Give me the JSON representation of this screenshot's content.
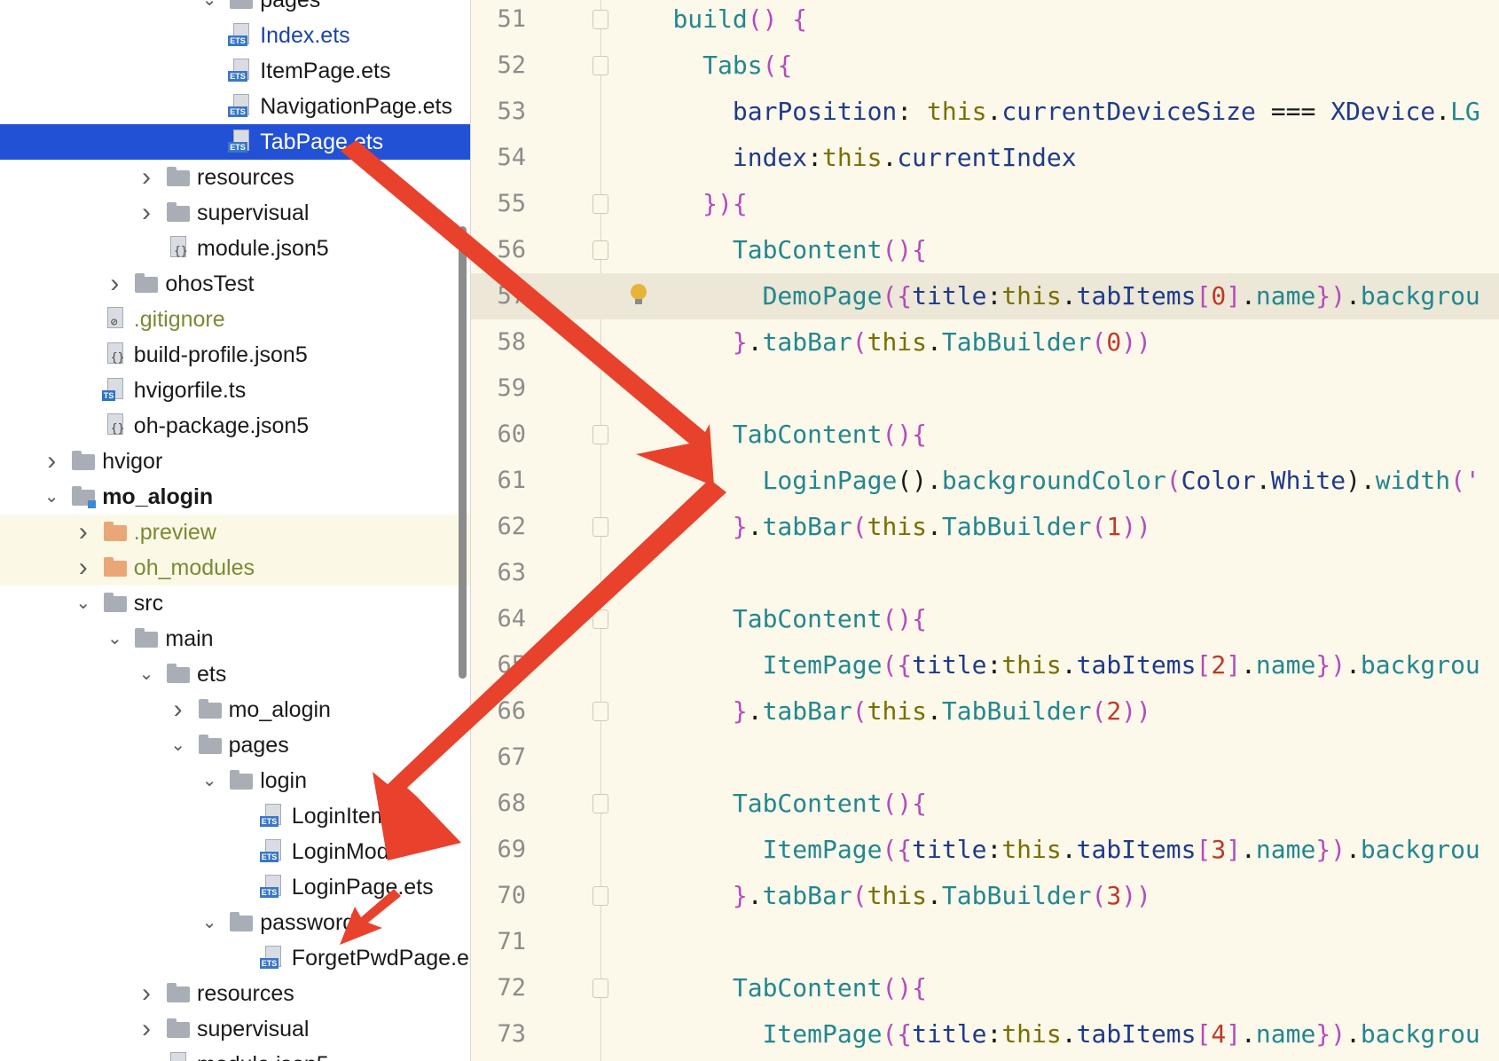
{
  "project_tree": {
    "items": [
      {
        "label": "pages",
        "depth": 7,
        "kind": "folder",
        "expand": "open"
      },
      {
        "label": "Index.ets",
        "depth": 7,
        "kind": "ets",
        "color": "#1c44a8"
      },
      {
        "label": "ItemPage.ets",
        "depth": 7,
        "kind": "ets"
      },
      {
        "label": "NavigationPage.ets",
        "depth": 7,
        "kind": "ets"
      },
      {
        "label": "TabPage.ets",
        "depth": 7,
        "kind": "ets",
        "selected": true
      },
      {
        "label": "resources",
        "depth": 5,
        "kind": "folder",
        "expand": "closed"
      },
      {
        "label": "supervisual",
        "depth": 5,
        "kind": "folder",
        "expand": "closed"
      },
      {
        "label": "module.json5",
        "depth": 5,
        "kind": "json"
      },
      {
        "label": "ohosTest",
        "depth": 4,
        "kind": "folder",
        "expand": "closed"
      },
      {
        "label": ".gitignore",
        "depth": 3,
        "kind": "ignore",
        "color": "#7b8a34"
      },
      {
        "label": "build-profile.json5",
        "depth": 3,
        "kind": "json"
      },
      {
        "label": "hvigorfile.ts",
        "depth": 3,
        "kind": "ts"
      },
      {
        "label": "oh-package.json5",
        "depth": 3,
        "kind": "json"
      },
      {
        "label": "hvigor",
        "depth": 2,
        "kind": "folder",
        "expand": "closed"
      },
      {
        "label": "mo_alogin",
        "depth": 2,
        "kind": "module",
        "expand": "open",
        "bold": true
      },
      {
        "label": ".preview",
        "depth": 3,
        "kind": "folder-orange",
        "expand": "closed",
        "color": "#7b8a34",
        "ignored": true
      },
      {
        "label": "oh_modules",
        "depth": 3,
        "kind": "folder-orange",
        "expand": "closed",
        "color": "#7b8a34",
        "ignored": true
      },
      {
        "label": "src",
        "depth": 3,
        "kind": "folder",
        "expand": "open"
      },
      {
        "label": "main",
        "depth": 4,
        "kind": "folder",
        "expand": "open"
      },
      {
        "label": "ets",
        "depth": 5,
        "kind": "folder",
        "expand": "open"
      },
      {
        "label": "mo_alogin",
        "depth": 6,
        "kind": "folder",
        "expand": "closed"
      },
      {
        "label": "pages",
        "depth": 6,
        "kind": "folder",
        "expand": "open"
      },
      {
        "label": "login",
        "depth": 7,
        "kind": "folder",
        "expand": "open"
      },
      {
        "label": "LoginItems",
        "depth": 8,
        "kind": "ets"
      },
      {
        "label": "LoginMod",
        "depth": 8,
        "kind": "ets"
      },
      {
        "label": "LoginPage.ets",
        "depth": 8,
        "kind": "ets"
      },
      {
        "label": "password",
        "depth": 7,
        "kind": "folder",
        "expand": "open"
      },
      {
        "label": "ForgetPwdPage.e",
        "depth": 8,
        "kind": "ets"
      },
      {
        "label": "resources",
        "depth": 5,
        "kind": "folder",
        "expand": "closed"
      },
      {
        "label": "supervisual",
        "depth": 5,
        "kind": "folder",
        "expand": "closed"
      },
      {
        "label": "module.json5",
        "depth": 5,
        "kind": "json"
      }
    ]
  },
  "file_tags": {
    "ets": "ETS",
    "ts": "TS"
  },
  "editor": {
    "lines": [
      {
        "n": "51",
        "fold": true,
        "code": [
          [
            "    ",
            "p"
          ],
          [
            "build",
            "f"
          ],
          [
            "() {",
            "b"
          ]
        ]
      },
      {
        "n": "52",
        "fold": true,
        "code": [
          [
            "      ",
            "p"
          ],
          [
            "Tabs",
            "f"
          ],
          [
            "({",
            "b"
          ]
        ]
      },
      {
        "n": "53",
        "code": [
          [
            "        ",
            "p"
          ],
          [
            "barPosition",
            "pr"
          ],
          [
            ": ",
            "p"
          ],
          [
            "this",
            "k"
          ],
          [
            ".",
            "p"
          ],
          [
            "currentDeviceSize",
            "pr"
          ],
          [
            " === ",
            "p"
          ],
          [
            "XDevice",
            "pr"
          ],
          [
            ".",
            "p"
          ],
          [
            "LG",
            "f"
          ]
        ]
      },
      {
        "n": "54",
        "code": [
          [
            "        ",
            "p"
          ],
          [
            "index",
            "pr"
          ],
          [
            ":",
            "p"
          ],
          [
            "this",
            "k"
          ],
          [
            ".",
            "p"
          ],
          [
            "currentIndex",
            "pr"
          ]
        ]
      },
      {
        "n": "55",
        "fold": true,
        "code": [
          [
            "      ",
            "p"
          ],
          [
            "})",
            "b"
          ],
          [
            "{",
            "b"
          ]
        ]
      },
      {
        "n": "56",
        "fold": true,
        "code": [
          [
            "        ",
            "p"
          ],
          [
            "TabContent",
            "f"
          ],
          [
            "(){",
            "b"
          ]
        ]
      },
      {
        "n": "57",
        "highlight": true,
        "bulb": true,
        "code": [
          [
            "          ",
            "p"
          ],
          [
            "DemoPage",
            "f"
          ],
          [
            "({",
            "b"
          ],
          [
            "title",
            "pr"
          ],
          [
            ":",
            "p"
          ],
          [
            "this",
            "k"
          ],
          [
            ".",
            "p"
          ],
          [
            "tabItems",
            "pr"
          ],
          [
            "[",
            "b"
          ],
          [
            "0",
            "n"
          ],
          [
            "]",
            "b"
          ],
          [
            ".",
            "p"
          ],
          [
            "name",
            "f"
          ],
          [
            "})",
            "b"
          ],
          [
            ".",
            "p"
          ],
          [
            "backgrou",
            "f"
          ]
        ]
      },
      {
        "n": "58",
        "code": [
          [
            "        ",
            "p"
          ],
          [
            "}",
            "b"
          ],
          [
            ".",
            "p"
          ],
          [
            "tabBar",
            "f"
          ],
          [
            "(",
            "b"
          ],
          [
            "this",
            "k"
          ],
          [
            ".",
            "p"
          ],
          [
            "TabBuilder",
            "f"
          ],
          [
            "(",
            "b"
          ],
          [
            "0",
            "n"
          ],
          [
            "))",
            "b"
          ]
        ]
      },
      {
        "n": "59",
        "code": []
      },
      {
        "n": "60",
        "fold": true,
        "code": [
          [
            "        ",
            "p"
          ],
          [
            "TabContent",
            "f"
          ],
          [
            "(){",
            "b"
          ]
        ]
      },
      {
        "n": "61",
        "code": [
          [
            "          ",
            "p"
          ],
          [
            "LoginPage",
            "f"
          ],
          [
            "().",
            "p"
          ],
          [
            "backgroundColor",
            "f"
          ],
          [
            "(",
            "b"
          ],
          [
            "Color",
            "pr"
          ],
          [
            ".",
            "p"
          ],
          [
            "White",
            "pr"
          ],
          [
            ").",
            "p"
          ],
          [
            "width",
            "f"
          ],
          [
            "('",
            "b"
          ]
        ]
      },
      {
        "n": "62",
        "fold": true,
        "code": [
          [
            "        ",
            "p"
          ],
          [
            "}",
            "b"
          ],
          [
            ".",
            "p"
          ],
          [
            "tabBar",
            "f"
          ],
          [
            "(",
            "b"
          ],
          [
            "this",
            "k"
          ],
          [
            ".",
            "p"
          ],
          [
            "TabBuilder",
            "f"
          ],
          [
            "(",
            "b"
          ],
          [
            "1",
            "n"
          ],
          [
            "))",
            "b"
          ]
        ]
      },
      {
        "n": "63",
        "code": []
      },
      {
        "n": "64",
        "fold": true,
        "code": [
          [
            "        ",
            "p"
          ],
          [
            "TabContent",
            "f"
          ],
          [
            "(){",
            "b"
          ]
        ]
      },
      {
        "n": "65",
        "code": [
          [
            "          ",
            "p"
          ],
          [
            "ItemPage",
            "f"
          ],
          [
            "({",
            "b"
          ],
          [
            "title",
            "pr"
          ],
          [
            ":",
            "p"
          ],
          [
            "this",
            "k"
          ],
          [
            ".",
            "p"
          ],
          [
            "tabItems",
            "pr"
          ],
          [
            "[",
            "b"
          ],
          [
            "2",
            "n"
          ],
          [
            "]",
            "b"
          ],
          [
            ".",
            "p"
          ],
          [
            "name",
            "f"
          ],
          [
            "})",
            "b"
          ],
          [
            ".",
            "p"
          ],
          [
            "backgrou",
            "f"
          ]
        ]
      },
      {
        "n": "66",
        "fold": true,
        "code": [
          [
            "        ",
            "p"
          ],
          [
            "}",
            "b"
          ],
          [
            ".",
            "p"
          ],
          [
            "tabBar",
            "f"
          ],
          [
            "(",
            "b"
          ],
          [
            "this",
            "k"
          ],
          [
            ".",
            "p"
          ],
          [
            "TabBuilder",
            "f"
          ],
          [
            "(",
            "b"
          ],
          [
            "2",
            "n"
          ],
          [
            "))",
            "b"
          ]
        ]
      },
      {
        "n": "67",
        "code": []
      },
      {
        "n": "68",
        "fold": true,
        "code": [
          [
            "        ",
            "p"
          ],
          [
            "TabContent",
            "f"
          ],
          [
            "(){",
            "b"
          ]
        ]
      },
      {
        "n": "69",
        "code": [
          [
            "          ",
            "p"
          ],
          [
            "ItemPage",
            "f"
          ],
          [
            "({",
            "b"
          ],
          [
            "title",
            "pr"
          ],
          [
            ":",
            "p"
          ],
          [
            "this",
            "k"
          ],
          [
            ".",
            "p"
          ],
          [
            "tabItems",
            "pr"
          ],
          [
            "[",
            "b"
          ],
          [
            "3",
            "n"
          ],
          [
            "]",
            "b"
          ],
          [
            ".",
            "p"
          ],
          [
            "name",
            "f"
          ],
          [
            "})",
            "b"
          ],
          [
            ".",
            "p"
          ],
          [
            "backgrou",
            "f"
          ]
        ]
      },
      {
        "n": "70",
        "fold": true,
        "code": [
          [
            "        ",
            "p"
          ],
          [
            "}",
            "b"
          ],
          [
            ".",
            "p"
          ],
          [
            "tabBar",
            "f"
          ],
          [
            "(",
            "b"
          ],
          [
            "this",
            "k"
          ],
          [
            ".",
            "p"
          ],
          [
            "TabBuilder",
            "f"
          ],
          [
            "(",
            "b"
          ],
          [
            "3",
            "n"
          ],
          [
            "))",
            "b"
          ]
        ]
      },
      {
        "n": "71",
        "code": []
      },
      {
        "n": "72",
        "fold": true,
        "code": [
          [
            "        ",
            "p"
          ],
          [
            "TabContent",
            "f"
          ],
          [
            "(){",
            "b"
          ]
        ]
      },
      {
        "n": "73",
        "code": [
          [
            "          ",
            "p"
          ],
          [
            "ItemPage",
            "f"
          ],
          [
            "({",
            "b"
          ],
          [
            "title",
            "pr"
          ],
          [
            ":",
            "p"
          ],
          [
            "this",
            "k"
          ],
          [
            ".",
            "p"
          ],
          [
            "tabItems",
            "pr"
          ],
          [
            "[",
            "b"
          ],
          [
            "4",
            "n"
          ],
          [
            "]",
            "b"
          ],
          [
            ".",
            "p"
          ],
          [
            "name",
            "f"
          ],
          [
            "})",
            "b"
          ],
          [
            ".",
            "p"
          ],
          [
            "backgrou",
            "f"
          ]
        ]
      }
    ]
  },
  "syntax_colors": {
    "f": "#22878f",
    "b": "#b44bbd",
    "pr": "#1e3a8a",
    "k": "#7a6f00",
    "n": "#c0392b",
    "p": "#1a1a1a"
  },
  "annotation": {
    "arrow_color": "#e8412c",
    "arrows": [
      "tabpage-to-loginpage-call",
      "loginpage-call-to-loginpage-file",
      "to-forgetpwdpage"
    ]
  }
}
